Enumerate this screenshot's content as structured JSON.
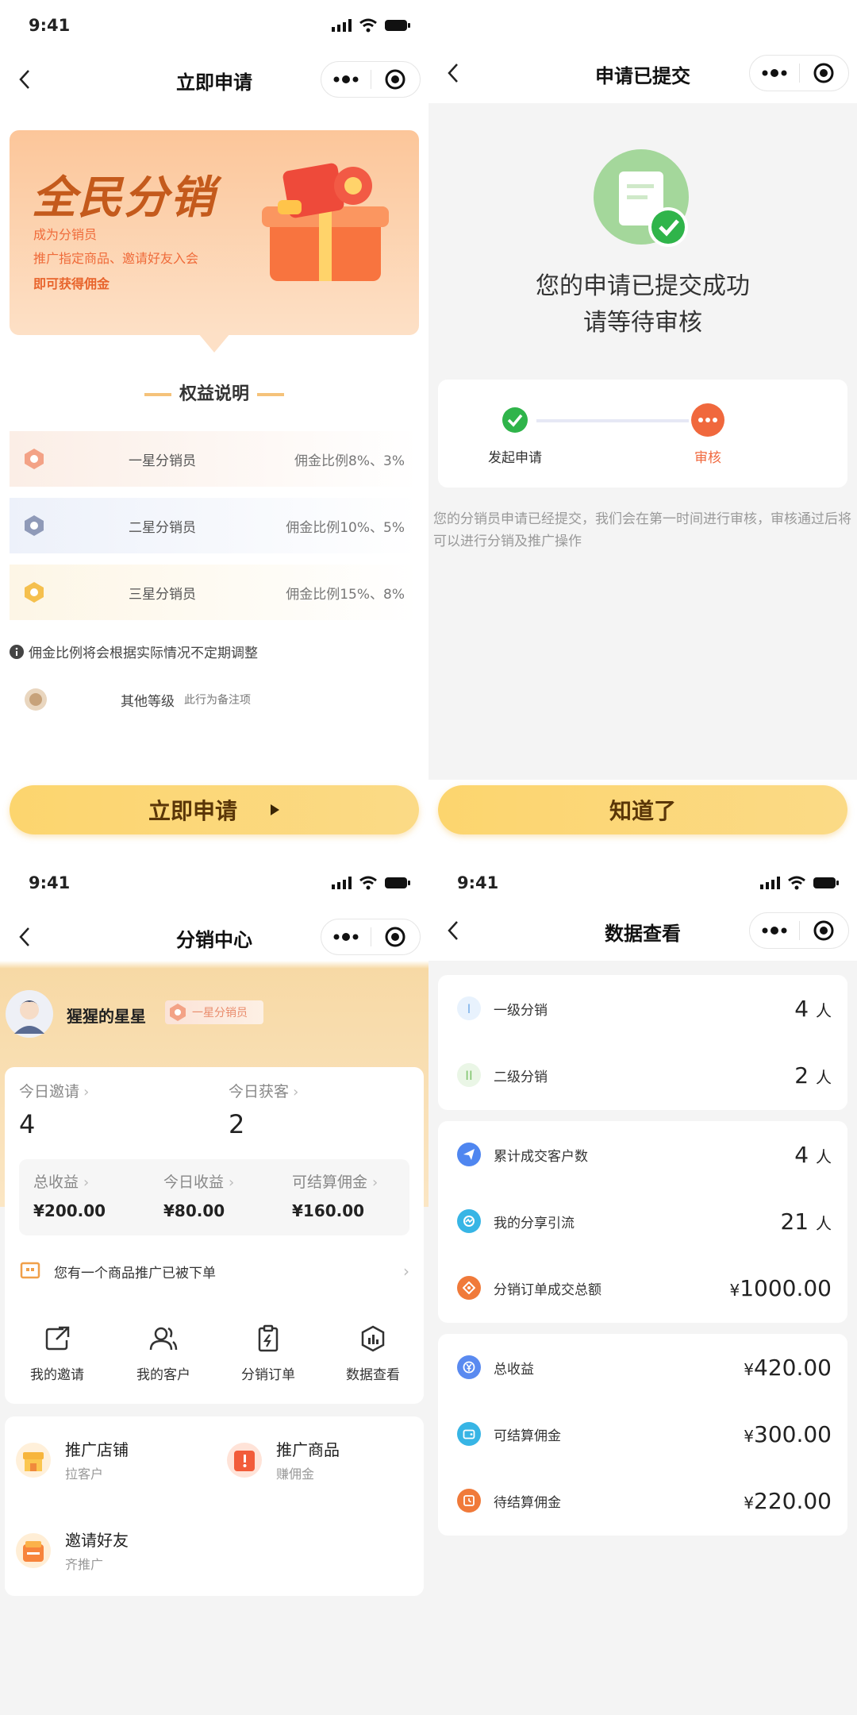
{
  "status_time": "9:41",
  "apply": {
    "title": "立即申请",
    "banner_title": "全民分销",
    "banner_lines": [
      "成为分销员",
      "推广指定商品、邀请好友入会",
      "即可获得佣金"
    ],
    "section_title": "权益说明",
    "tiers": [
      {
        "name": "一星分销员",
        "commission": "佣金比例8%、3%",
        "color": "#f3a286"
      },
      {
        "name": "二星分销员",
        "commission": "佣金比例10%、5%",
        "color": "#8f9ab8"
      },
      {
        "name": "三星分销员",
        "commission": "佣金比例15%、8%",
        "color": "#f5c04e"
      }
    ],
    "note": "佣金比例将会根据实际情况不定期调整",
    "other_level": "其他等级",
    "other_note": "此行为备注项",
    "button": "立即申请"
  },
  "submitted": {
    "title": "申请已提交",
    "message_line1": "您的申请已提交成功",
    "message_line2": "请等待审核",
    "step1": "发起申请",
    "step2": "审核",
    "desc": "您的分销员申请已经提交，我们会在第一时间进行审核，审核通过后将可以进行分销及推广操作",
    "button": "知道了"
  },
  "center": {
    "title": "分销中心",
    "username": "猩猩的星星",
    "badge": "一星分销员",
    "today_invite_label": "今日邀请",
    "today_invite_value": "4",
    "today_customer_label": "今日获客",
    "today_customer_value": "2",
    "total_income_label": "总收益",
    "total_income_value": "¥200.00",
    "today_income_label": "今日收益",
    "today_income_value": "¥80.00",
    "settle_label": "可结算佣金",
    "settle_value": "¥160.00",
    "notice": "您有一个商品推广已被下单",
    "grid": [
      "我的邀请",
      "我的客户",
      "分销订单",
      "数据查看"
    ],
    "promos": [
      {
        "title": "推广店铺",
        "sub": "拉客户"
      },
      {
        "title": "推广商品",
        "sub": "赚佣金"
      },
      {
        "title": "邀请好友",
        "sub": "齐推广"
      }
    ]
  },
  "data_view": {
    "title": "数据查看",
    "group1": [
      {
        "label": "一级分销",
        "value": "4",
        "unit": "人"
      },
      {
        "label": "二级分销",
        "value": "2",
        "unit": "人"
      }
    ],
    "group2": [
      {
        "label": "累计成交客户数",
        "value": "4",
        "unit": "人"
      },
      {
        "label": "我的分享引流",
        "value": "21",
        "unit": "人"
      },
      {
        "label": "分销订单成交总额",
        "value": "1000.00",
        "unit": "¥"
      }
    ],
    "group3": [
      {
        "label": "总收益",
        "value": "420.00",
        "unit": "¥"
      },
      {
        "label": "可结算佣金",
        "value": "300.00",
        "unit": "¥"
      },
      {
        "label": "待结算佣金",
        "value": "220.00",
        "unit": "¥"
      }
    ]
  }
}
